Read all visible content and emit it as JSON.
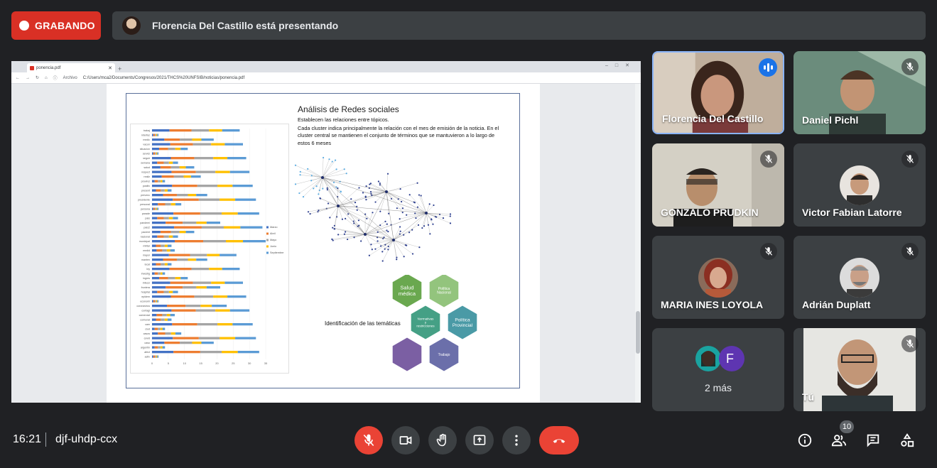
{
  "recording": {
    "label": "GRABANDO"
  },
  "presenter_bar": {
    "text": "Florencia Del Castillo está presentando"
  },
  "browser": {
    "tab_title": "ponencia.pdf",
    "address_prefix": "Archivo",
    "url": "C:/Users/mca2/Documents/Congresos/2021/THCS%20UNFSIB/noticias/ponencia.pdf"
  },
  "slide": {
    "title": "Análisis de Redes sociales",
    "line1": "Establecen las relaciones entre tópicos.",
    "line2": " Cada cluster indica principalmente la relación con el mes de emisión de la noticia. En el cluster central se mantienen el conjunto de términos que se mantuvieron a lo largo de estos 6 meses",
    "identification_label": "Identificación de las temáticas",
    "hexagons": [
      {
        "label": "Salud médica",
        "color": "#6aa84f"
      },
      {
        "label": "Política Nacional",
        "color": "#93c47d"
      },
      {
        "label": "Normativas y restricciones",
        "color": "#45a085"
      },
      {
        "label": "Política Provincial",
        "color": "#4a9aa6"
      },
      {
        "label": "",
        "color": "#7b5fa3"
      },
      {
        "label": "Trabajo",
        "color": "#6b6faa"
      }
    ],
    "chart": {
      "categories": [
        "trabaj",
        "interfaz",
        "medic",
        "vacun",
        "situacion",
        "servici",
        "seguir",
        "semana",
        "salud",
        "respect",
        "realiz",
        "provinci",
        "positiv",
        "present",
        "prevenc",
        "presidente",
        "personal",
        "persona",
        "parade",
        "pais",
        "pandemi",
        "pais2",
        "pacient",
        "nacional",
        "municipal",
        "militar",
        "medid",
        "mayor",
        "manten",
        "local",
        "ley",
        "investig",
        "ingres",
        "infecci",
        "frontera",
        "hospital",
        "epidem",
        "economi",
        "coronavirus",
        "contagi",
        "comercial",
        "comunal",
        "cam",
        "ciud",
        "casos",
        "covid",
        "caso",
        "argentin",
        "afect",
        "activ"
      ],
      "series_names": [
        "Marzo",
        "Abril",
        "Mayo",
        "Junio",
        "Septiembre"
      ],
      "series_colors": [
        "#4472c4",
        "#ed7d31",
        "#a5a5a5",
        "#ffc000",
        "#5b9bd5"
      ],
      "x_ticks": [
        "0",
        "5",
        "10",
        "15",
        "20",
        "25",
        "30",
        "35"
      ]
    }
  },
  "participants": [
    {
      "name": "Florencia Del Castillo",
      "speaking": true
    },
    {
      "name": "Daniel Pichl",
      "muted": true
    },
    {
      "name": "GONZALO PRUDKIN",
      "muted": true
    },
    {
      "name": "Victor Fabian Latorre",
      "muted": true
    },
    {
      "name": "MARIA INES LOYOLA",
      "muted": true
    },
    {
      "name": "Adrián Duplatt",
      "muted": true
    },
    {
      "name": "2 más",
      "initial": "F"
    },
    {
      "name": "Tú",
      "muted": true
    }
  ],
  "meeting": {
    "time": "16:21",
    "code": "djf-uhdp-ccx",
    "participant_count": "10"
  },
  "colors": {
    "recording_red": "#d93025",
    "hangup_red": "#ea4335",
    "active_border": "#8ab4f8",
    "speaking_blue": "#1a73e8"
  }
}
